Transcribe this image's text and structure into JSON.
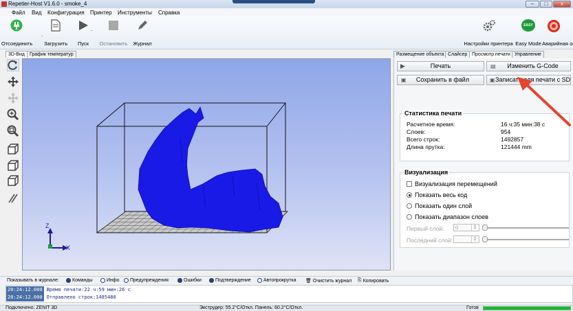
{
  "window": {
    "title": "Repetier-Host V1.6.0 - smoke_4",
    "minimize": "–",
    "maximize": "□",
    "close": "x"
  },
  "menu": [
    "Файл",
    "Вид",
    "Конфигурация",
    "Принтер",
    "Инструменты",
    "Справка"
  ],
  "toolbar": {
    "connect": "Отсоединить",
    "load": "Загрузить",
    "start": "Пуск",
    "stop": "Остановить",
    "journal": "Журнал",
    "printer_settings": "Настройки принтера",
    "easy_mode": "Easy Mode",
    "easy_badge": "EASY",
    "emergency": "Аварийная остановка"
  },
  "left_tabs": [
    "3D-Вид",
    "График температур"
  ],
  "right_tabs": [
    "Размещение объекта",
    "Слайсер",
    "Просмотр печати",
    "Управление"
  ],
  "viewport": {
    "axis_z": "Z",
    "axis_x": "X"
  },
  "right_panel": {
    "print_btn": "Печать",
    "edit_gcode_btn": "Изменить G-Code",
    "save_file_btn": "Сохранить в файл",
    "sd_btn": "Записать для печати с SD",
    "stats": {
      "title": "Статистика печати",
      "rows": [
        {
          "label": "Расчетное время:",
          "value": "16 ч:35 мин:38 с"
        },
        {
          "label": "Слоев:",
          "value": "954"
        },
        {
          "label": "Всего строк:",
          "value": "1492857"
        },
        {
          "label": "Длина прутка:",
          "value": "121444 mm"
        }
      ]
    },
    "viz": {
      "title": "Визуализация",
      "show_moves": "Визуализация перемещений",
      "show_all": "Показать весь код",
      "show_one": "Показать один слой",
      "show_range": "Показать диапазон слоев",
      "first_layer": "Первый слой:",
      "last_layer": "Последний слой:",
      "first_value": "0",
      "last_value": ""
    }
  },
  "log_filters": {
    "label": "Показывать в журнале:",
    "commands": "Команды",
    "info": "Инфо",
    "warnings": "Предупреждения",
    "errors": "Ошибки",
    "ack": "Подтверждение",
    "autoscroll": "Автопрокрутка",
    "clear": "Очистить журнал",
    "copy": "Копировать"
  },
  "log": [
    {
      "time": "20:24:12.000",
      "msg": "Время печати:22 ч:59 мин:26 с"
    },
    {
      "time": "20:24:12.000",
      "msg": "Отправлено строк:1485480"
    }
  ],
  "status": {
    "connection": "Подключено: ZENIT 3D",
    "temps": "Экструдер: 55.2°C/Откл. Панель: 60.2°C/Откл.",
    "state": "Готов",
    "progress": 1.0
  },
  "colors": {
    "model": "#1a1ae6",
    "progress": "#21b531",
    "arrow": "#e8432e"
  }
}
